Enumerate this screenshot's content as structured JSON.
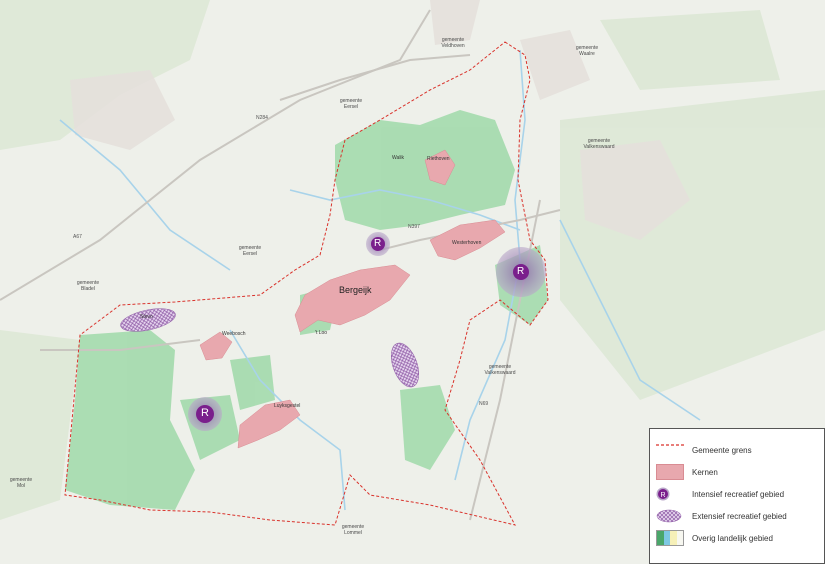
{
  "map_labels": {
    "veldhoven": "gemeente\nVeldhoven",
    "waalre": "gemeente\nWaalre",
    "eersel_north": "gemeente\nEersel",
    "eersel_mid": "gemeente\nEersel",
    "valkenswaard_east": "gemeente\nValkenswaard",
    "valkenswaard_south": "gemeente\nValkenswaard",
    "bladel": "gemeente\nBladel",
    "mol": "gemeente\nMol",
    "lommel": "gemeente\nLommel"
  },
  "roads": {
    "n284": "N284",
    "a67": "A67",
    "n397": "N397",
    "n69": "N69"
  },
  "towns": {
    "bergeijk": "Bergeijk",
    "westerhoven": "Westerhoven",
    "riethoven": "Riethoven",
    "walik": "Walik",
    "weebosch": "Weebosch",
    "luyksgestel": "Luyksgestel",
    "t_loo": "'t Loo",
    "stevo": "Stevo"
  },
  "recreation_marker_letter": "R",
  "legend": {
    "boundary": "Gemeente grens",
    "cores": "Kernen",
    "intensive": "Intensief recreatief gebied",
    "extensive": "Extensief recreatief gebied",
    "rural": "Overig landelijk gebied"
  },
  "colors": {
    "background": "#eef0ea",
    "green": "#9fd9a9",
    "core": "#e8a8ae",
    "boundary": "#d9322b",
    "intensive": "#7a1f8c",
    "extensive": "#9d7bb0",
    "water": "#a8d3ea"
  }
}
